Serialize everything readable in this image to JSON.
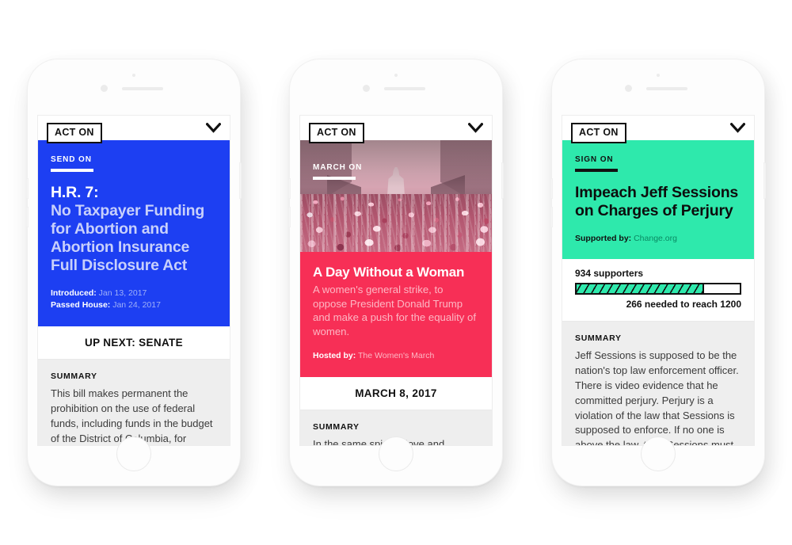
{
  "phones": [
    {
      "id": "phone-bill",
      "brand_badge": "ACT ON",
      "chevron_icon": "chevron-down-icon",
      "hero_style": "blue",
      "accent_color": "#1d3ff2",
      "kicker": "SEND ON",
      "headline_lead": "H.R. 7:",
      "headline_rest": "No Taxpayer Funding for Abortion and Abortion Insurance Full Disclosure Act",
      "meta": [
        {
          "key": "Introduced:",
          "value": "Jan 13, 2017"
        },
        {
          "key": "Passed House:",
          "value": "Jan 24, 2017"
        }
      ],
      "status_strip": "UP NEXT: SENATE",
      "summary_label": "SUMMARY",
      "summary_text": "This bill makes permanent the prohibition on the use of federal funds, including funds in the budget of the District of Columbia, for abortion or health coverage"
    },
    {
      "id": "phone-march",
      "brand_badge": "ACT ON",
      "chevron_icon": "chevron-down-icon",
      "hero_style": "photo",
      "accent_color": "#f72f56",
      "kicker": "MARCH ON",
      "photo_alt": "Aerial photograph of the Women's March crowd filling Pennsylvania Avenue toward the U.S. Capitol",
      "headline": "A Day Without a Woman",
      "body": "A women's general strike, to oppose President Donald Trump and make a push for the equality of women.",
      "meta": [
        {
          "key": "Hosted by:",
          "value": "The Women's March"
        }
      ],
      "status_strip": "MARCH 8, 2017",
      "summary_label": "SUMMARY",
      "summary_text": "In the same spirit of love and"
    },
    {
      "id": "phone-petition",
      "brand_badge": "ACT ON",
      "chevron_icon": "chevron-down-icon",
      "hero_style": "mint",
      "accent_color": "#2ee9ac",
      "kicker": "SIGN ON",
      "headline": "Impeach Jeff Sessions on Charges of Perjury",
      "meta": [
        {
          "key": "Supported by:",
          "value": "Change.org"
        }
      ],
      "meter": {
        "count_label": "934 supporters",
        "supporters": 934,
        "goal": 1200,
        "needed_label": "266 needed to reach 1200",
        "fill_percent": 78
      },
      "summary_label": "SUMMARY",
      "summary_text": "Jeff Sessions is supposed to be the nation's top law enforcement officer. There is video evidence that he committed perjury. Perjury is a violation of the law that Sessions is supposed to enforce. If no one is above the law, then Sessions must resign, be fired, or"
    }
  ]
}
